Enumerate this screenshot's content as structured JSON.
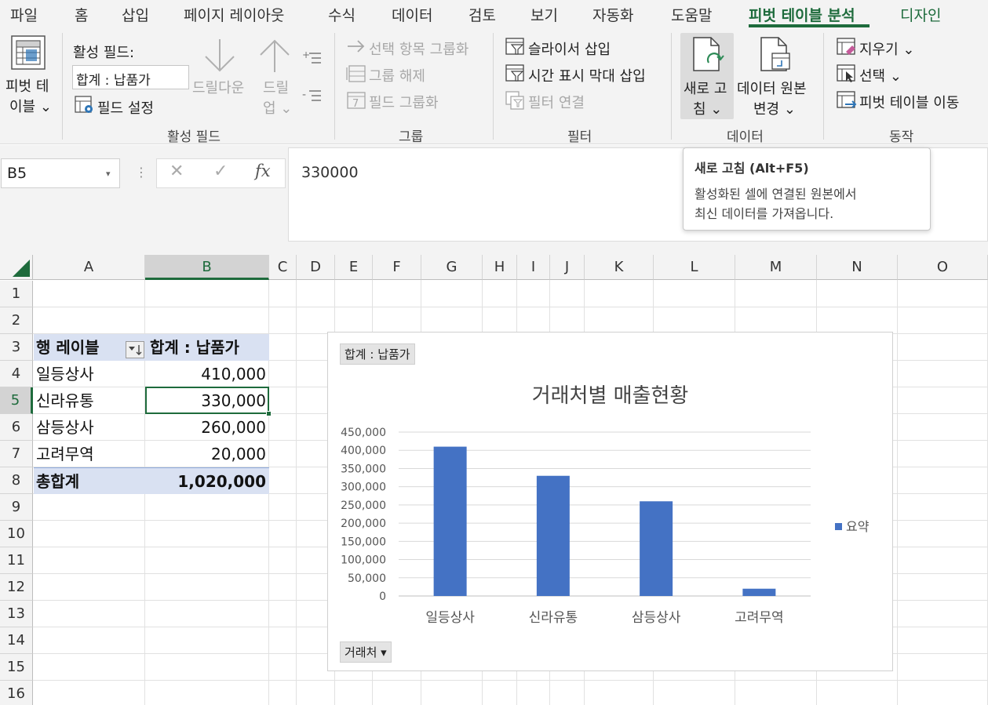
{
  "tabs": [
    "파일",
    "홈",
    "삽입",
    "페이지 레이아웃",
    "수식",
    "데이터",
    "검토",
    "보기",
    "자동화",
    "도움말",
    "피벗 테이블 분석",
    "디자인"
  ],
  "active_tab": "피벗 테이블 분석",
  "ribbon": {
    "pivot_table": {
      "line1": "피벗 테",
      "line2": "이블 ⌄"
    },
    "active_field": {
      "label": "활성 필드:",
      "value": "합계 : 납품가",
      "field_settings": "필드 설정",
      "drill_down": "드릴다운",
      "drill_up_1": "드릴",
      "drill_up_2": "업 ⌄",
      "group_label": "활성 필드"
    },
    "group": {
      "group_selection": "선택 항목 그룹화",
      "ungroup": "그룹 해제",
      "group_field": "필드 그룹화",
      "group_label": "그룹"
    },
    "filter": {
      "insert_slicer": "슬라이서 삽입",
      "insert_timeline": "시간 표시 막대 삽입",
      "filter_connections": "필터 연결",
      "group_label": "필터"
    },
    "data": {
      "refresh_1": "새로 고",
      "refresh_2": "침 ⌄",
      "change_source_1": "데이터 원본",
      "change_source_2": "변경 ⌄",
      "group_label": "데이터"
    },
    "actions": {
      "clear": "지우기 ⌄",
      "select": "선택 ⌄",
      "move": "피벗 테이블 이동",
      "group_label": "동작"
    }
  },
  "tooltip": {
    "title": "새로 고침 (Alt+F5)",
    "line1": "활성화된 셀에 연결된 원본에서",
    "line2": "최신 데이터를 가져옵니다."
  },
  "formula_bar": {
    "name_box": "B5",
    "formula": "330000",
    "fx": "fx"
  },
  "columns": [
    "A",
    "B",
    "C",
    "D",
    "E",
    "F",
    "G",
    "H",
    "I",
    "J",
    "K",
    "L",
    "M",
    "N",
    "O"
  ],
  "selected_column": "B",
  "rows": [
    "1",
    "2",
    "3",
    "4",
    "5",
    "6",
    "7",
    "8",
    "9",
    "10",
    "11",
    "12",
    "13",
    "14",
    "15",
    "16"
  ],
  "selected_row": "5",
  "pivot": {
    "header_row_label": "행 레이블",
    "header_value_label": "합계 : 납품가",
    "rows": [
      {
        "label": "일등상사",
        "value": "410,000"
      },
      {
        "label": "신라유통",
        "value": "330,000"
      },
      {
        "label": "삼등상사",
        "value": "260,000"
      },
      {
        "label": "고려무역",
        "value": "20,000"
      }
    ],
    "total_label": "총합계",
    "total_value": "1,020,000"
  },
  "chart": {
    "value_field_button": "합계 : 납품가",
    "axis_field_button": "거래처 ▾"
  },
  "colors": {
    "accent": "#1e6b3c",
    "bar": "#4472c4",
    "pivot_header": "#d9e1f2"
  },
  "chart_data": {
    "type": "bar",
    "title": "거래처별 매출현황",
    "categories": [
      "일등상사",
      "신라유통",
      "삼등상사",
      "고려무역"
    ],
    "series": [
      {
        "name": "요약",
        "values": [
          410000,
          330000,
          260000,
          20000
        ]
      }
    ],
    "ylim": [
      0,
      450000
    ],
    "yticks": [
      "0",
      "50,000",
      "100,000",
      "150,000",
      "200,000",
      "250,000",
      "300,000",
      "350,000",
      "400,000",
      "450,000"
    ],
    "grid": true,
    "legend": "right"
  }
}
